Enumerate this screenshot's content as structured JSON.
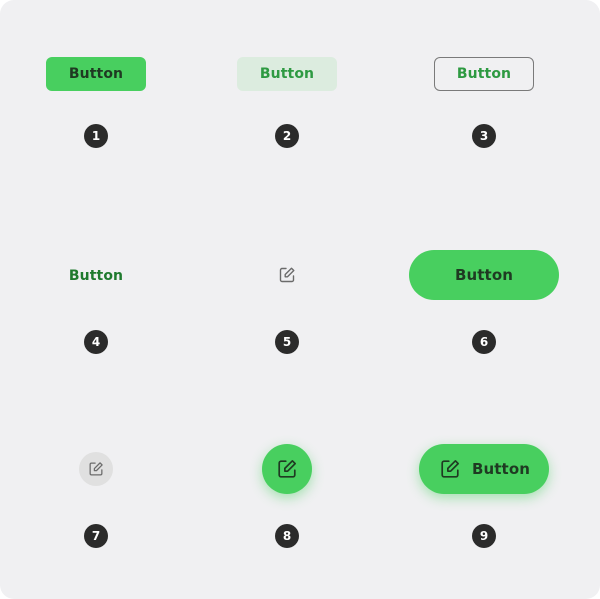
{
  "colors": {
    "accent": "#48cf5f",
    "accent_dark_text": "#1f7a2e",
    "tonal_bg": "#dcecdf",
    "outline_border": "#7a7a7a",
    "panel_bg": "#f0f0f2",
    "badge_bg": "#2b2b2b",
    "icon_circle_bg": "#e0e0e0"
  },
  "buttons": [
    {
      "variant": "filled",
      "label": "Button",
      "badge": "1"
    },
    {
      "variant": "tonal",
      "label": "Button",
      "badge": "2"
    },
    {
      "variant": "outlined",
      "label": "Button",
      "badge": "3"
    },
    {
      "variant": "text",
      "label": "Button",
      "badge": "4"
    },
    {
      "variant": "icon",
      "icon": "edit-icon",
      "badge": "5"
    },
    {
      "variant": "filled-pill",
      "label": "Button",
      "badge": "6"
    },
    {
      "variant": "icon-circle-gray",
      "icon": "edit-icon",
      "badge": "7"
    },
    {
      "variant": "fab-icon",
      "icon": "edit-icon",
      "badge": "8"
    },
    {
      "variant": "extended-fab",
      "icon": "edit-icon",
      "label": "Button",
      "badge": "9"
    }
  ]
}
